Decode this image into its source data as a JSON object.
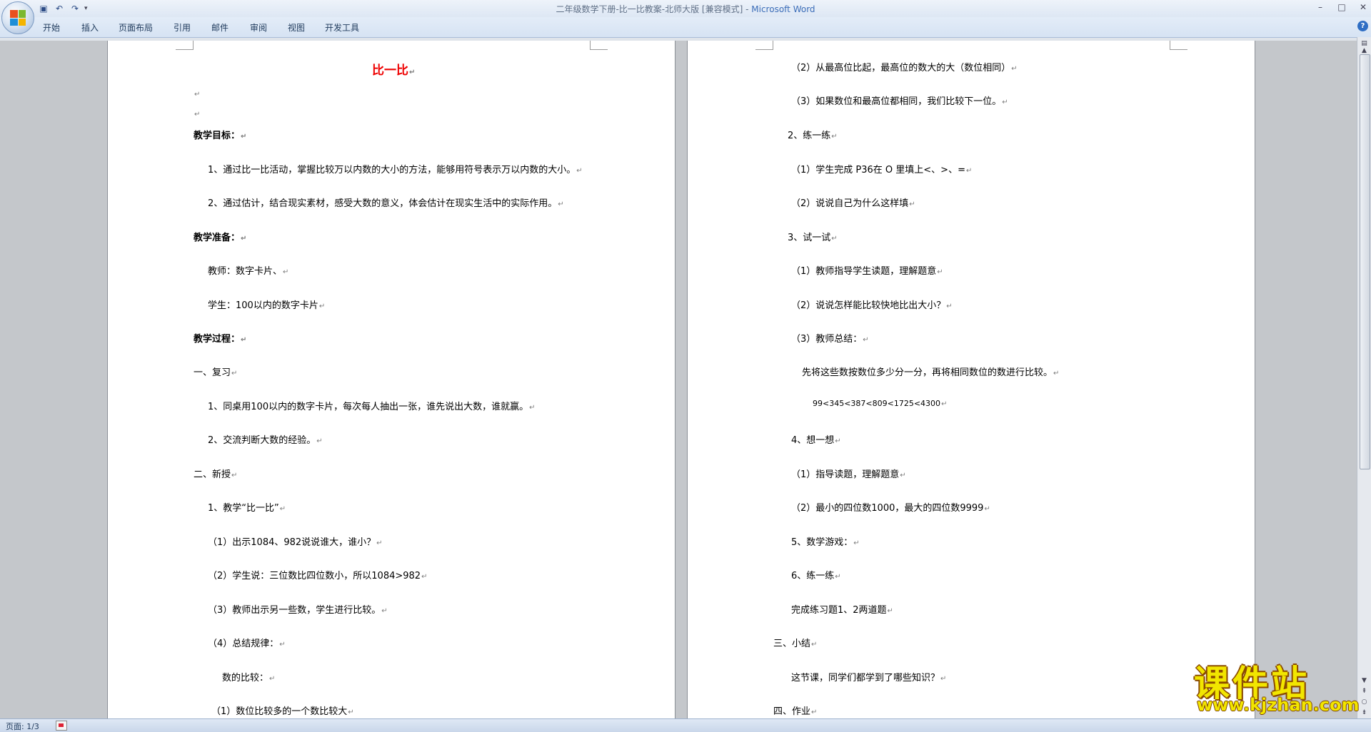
{
  "window": {
    "title_doc": "二年级数学下册-比一比教案-北师大版 [兼容模式] - ",
    "title_app": "Microsoft Word"
  },
  "ribbon": {
    "tabs": [
      "开始",
      "插入",
      "页面布局",
      "引用",
      "邮件",
      "审阅",
      "视图",
      "开发工具"
    ]
  },
  "status": {
    "page": "页面: 1/3"
  },
  "watermark": {
    "text": "课件站",
    "url": "www.kjzhan.com"
  },
  "document": {
    "left_page": [
      {
        "text": "比一比",
        "style": "title"
      },
      {
        "text": "",
        "style": "empty"
      },
      {
        "text": "",
        "style": "empty"
      },
      {
        "text": "教学目标：",
        "style": "bold"
      },
      {
        "text": "1、通过比一比活动，掌握比较万以内数的大小的方法，能够用符号表示万以内数的大小。",
        "style": "normal"
      },
      {
        "text": "2、通过估计，结合现实素材，感受大数的意义，体会估计在现实生活中的实际作用。",
        "style": "normal"
      },
      {
        "text": "教学准备：",
        "style": "bold"
      },
      {
        "text": "教师：数字卡片、",
        "style": "normal"
      },
      {
        "text": "学生：100以内的数字卡片",
        "style": "normal"
      },
      {
        "text": "教学过程：",
        "style": "bold"
      },
      {
        "text": "一、复习",
        "style": "normal"
      },
      {
        "text": "1、同桌用100以内的数字卡片，每次每人抽出一张，谁先说出大数，谁就赢。",
        "style": "normal"
      },
      {
        "text": "2、交流判断大数的经验。",
        "style": "normal"
      },
      {
        "text": "二、新授",
        "style": "normal"
      },
      {
        "text": "1、教学“比一比”",
        "style": "normal"
      },
      {
        "text": "（1）出示1084、982说说谁大，谁小？",
        "style": "normal"
      },
      {
        "text": "（2）学生说：三位数比四位数小，所以1084>982",
        "style": "normal"
      },
      {
        "text": "（3）教师出示另一些数，学生进行比较。",
        "style": "normal"
      },
      {
        "text": "（4）总结规律：",
        "style": "normal"
      },
      {
        "text": "数的比较：",
        "style": "normal"
      },
      {
        "text": "（1）数位比较多的一个数比较大",
        "style": "normal"
      }
    ],
    "right_page": [
      {
        "text": "（2）从最高位比起，最高位的数大的大（数位相同）",
        "style": "normal"
      },
      {
        "text": "（3）如果数位和最高位都相同，我们比较下一位。",
        "style": "normal"
      },
      {
        "text": "2、练一练",
        "style": "normal"
      },
      {
        "text": "（1）学生完成 P36在 O 里填上<、>、=",
        "style": "normal"
      },
      {
        "text": "（2）说说自己为什么这样填",
        "style": "normal"
      },
      {
        "text": "3、试一试",
        "style": "normal"
      },
      {
        "text": "（1）教师指导学生读题，理解题意",
        "style": "normal"
      },
      {
        "text": "（2）说说怎样能比较快地比出大小？",
        "style": "normal"
      },
      {
        "text": "（3）教师总结：",
        "style": "normal"
      },
      {
        "text": "先将这些数按数位多少分一分，再将相同数位的数进行比较。",
        "style": "normal"
      },
      {
        "text": "99<345<387<809<1725<4300",
        "style": "normal"
      },
      {
        "text": "4、想一想",
        "style": "normal"
      },
      {
        "text": "（1）指导读题，理解题意",
        "style": "normal"
      },
      {
        "text": "（2）最小的四位数1000，最大的四位数9999",
        "style": "normal"
      },
      {
        "text": "5、数学游戏：",
        "style": "normal"
      },
      {
        "text": "6、练一练",
        "style": "normal"
      },
      {
        "text": "完成练习题1、2两道题",
        "style": "normal"
      },
      {
        "text": "三、小结",
        "style": "normal"
      },
      {
        "text": "这节课，同学们都学到了哪些知识？",
        "style": "normal"
      },
      {
        "text": "四、作业",
        "style": "normal"
      }
    ]
  }
}
